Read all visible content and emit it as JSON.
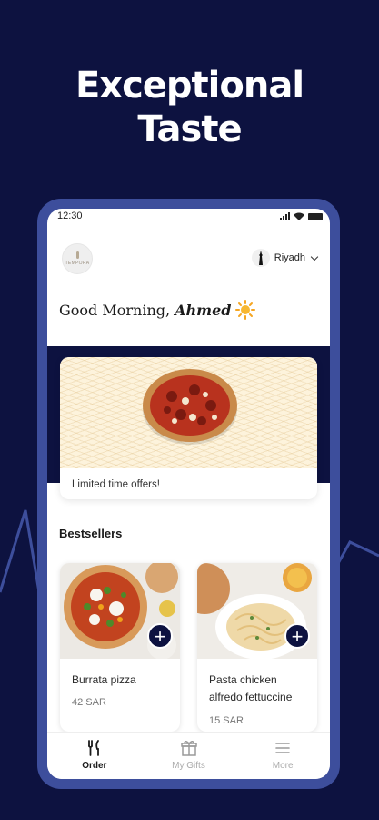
{
  "headline": {
    "line1": "Exceptional",
    "line2": "Taste"
  },
  "status_bar": {
    "time": "12:30"
  },
  "header": {
    "logo_text": "TEMPORA",
    "city": "Riyadh"
  },
  "greeting": {
    "prefix": "Good Morning,",
    "name": "Ahmed"
  },
  "offer": {
    "label": "Limited time offers!"
  },
  "bestsellers": {
    "title": "Bestsellers",
    "items": [
      {
        "name": "Burrata pizza",
        "price": "42 SAR",
        "add_label": "+"
      },
      {
        "name": "Pasta chicken alfredo fettuccine",
        "price": "15 SAR",
        "add_label": "+"
      }
    ]
  },
  "tabs": [
    {
      "label": "Order",
      "icon": "fork-knife-icon",
      "active": true
    },
    {
      "label": "My Gifts",
      "icon": "gift-icon",
      "active": false
    },
    {
      "label": "More",
      "icon": "menu-icon",
      "active": false
    }
  ],
  "colors": {
    "brand_navy": "#0d1240",
    "phone_frame": "#3d4e9c"
  }
}
